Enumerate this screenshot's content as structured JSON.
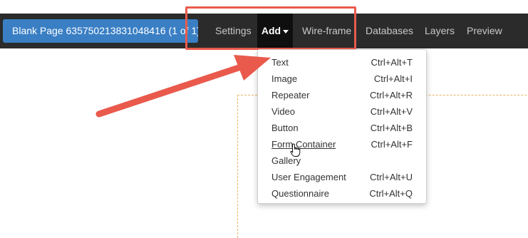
{
  "toolbar": {
    "page_button": "Blank Page 635750213831048416 (1 of 1)",
    "nav": {
      "settings": "Settings",
      "add": "Add",
      "wireframe": "Wire-frame",
      "databases": "Databases",
      "layers": "Layers",
      "preview": "Preview"
    }
  },
  "add_menu": {
    "items": [
      {
        "label": "Text",
        "shortcut": "Ctrl+Alt+T"
      },
      {
        "label": "Image",
        "shortcut": "Ctrl+Alt+I"
      },
      {
        "label": "Repeater",
        "shortcut": "Ctrl+Alt+R"
      },
      {
        "label": "Video",
        "shortcut": "Ctrl+Alt+V"
      },
      {
        "label": "Button",
        "shortcut": "Ctrl+Alt+B"
      },
      {
        "label": "Form Container",
        "shortcut": "Ctrl+Alt+F"
      },
      {
        "label": "Gallery",
        "shortcut": ""
      },
      {
        "label": "User Engagement",
        "shortcut": "Ctrl+Alt+U"
      },
      {
        "label": "Questionnaire",
        "shortcut": "Ctrl+Alt+Q"
      }
    ]
  },
  "colors": {
    "annotation": "#e95a4c",
    "primary_button": "#3a7fc4",
    "nav_bar": "#2b2b2b",
    "active_nav": "#0f0f0f"
  },
  "icons": {
    "caret": "caret-down-icon",
    "cursor": "hand-pointer-icon"
  }
}
